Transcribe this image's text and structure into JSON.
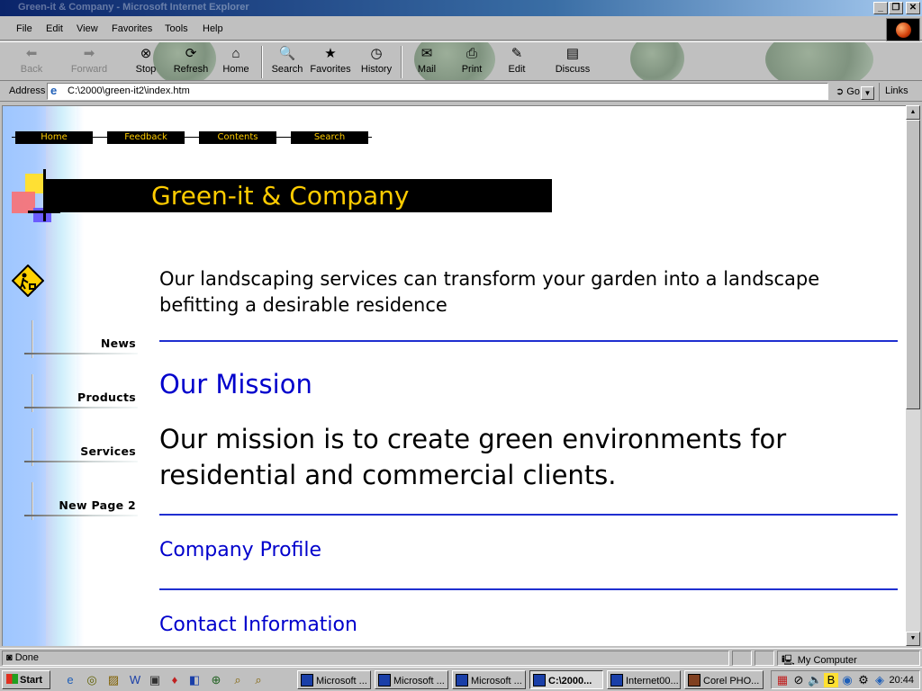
{
  "window": {
    "title": "Green-it & Company - Microsoft Internet Explorer",
    "buttons": {
      "minimize": "_",
      "maximize": "❐",
      "close": "✕"
    }
  },
  "menu": [
    "File",
    "Edit",
    "View",
    "Favorites",
    "Tools",
    "Help"
  ],
  "toolbar": {
    "back": "Back",
    "forward": "Forward",
    "stop": "Stop",
    "refresh": "Refresh",
    "home": "Home",
    "search": "Search",
    "favorites": "Favorites",
    "history": "History",
    "mail": "Mail",
    "print": "Print",
    "edit": "Edit",
    "discuss": "Discuss"
  },
  "address": {
    "label": "Address",
    "value": "C:\\2000\\green-it2\\index.htm",
    "go": "Go",
    "links": "Links"
  },
  "page": {
    "nav": [
      "Home",
      "Feedback",
      "Contents",
      "Search"
    ],
    "banner_title": "Green-it & Company",
    "side_links": [
      "News",
      "Products",
      "Services",
      "New Page 2"
    ],
    "intro": "Our landscaping services can transform your garden into a landscape befitting a desirable residence",
    "mission_heading": "Our Mission",
    "mission_text": "Our mission is to create green environments for residential and commercial clients.",
    "company_profile": "Company Profile",
    "contact_info": "Contact Information"
  },
  "status": {
    "text": "Done",
    "zone": "My Computer"
  },
  "taskbar": {
    "start": "Start",
    "tasks": [
      "Microsoft ...",
      "Microsoft ...",
      "Microsoft ...",
      "C:\\2000...",
      "Internet00...",
      "Corel PHO..."
    ],
    "clock": "20:44"
  },
  "colors": {
    "accent_blue": "#0000cc",
    "banner_text": "#ffcc00",
    "banner_bg": "#000000"
  }
}
